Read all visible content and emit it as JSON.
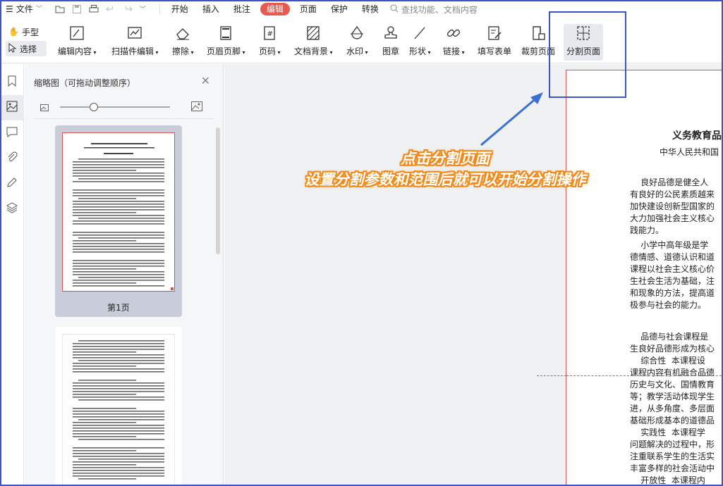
{
  "menubar": {
    "file": "文件",
    "tabs": [
      "开始",
      "插入",
      "批注",
      "编辑",
      "页面",
      "保护",
      "转换"
    ],
    "active_tab": "编辑",
    "search_placeholder": "查找功能、文档内容"
  },
  "toolbar": {
    "hand": "手型",
    "select": "选择",
    "tools": [
      {
        "label": "编辑内容",
        "icon": "edit-content-icon"
      },
      {
        "label": "扫描件编辑",
        "icon": "scan-edit-icon"
      },
      {
        "label": "擦除",
        "icon": "eraser-icon"
      },
      {
        "label": "页眉页脚",
        "icon": "header-footer-icon"
      },
      {
        "label": "页码",
        "icon": "page-number-icon"
      },
      {
        "label": "文档背景",
        "icon": "background-icon"
      },
      {
        "label": "水印",
        "icon": "watermark-icon"
      },
      {
        "label": "图章",
        "icon": "stamp-icon"
      },
      {
        "label": "形状",
        "icon": "shape-icon"
      },
      {
        "label": "链接",
        "icon": "link-icon"
      },
      {
        "label": "填写表单",
        "icon": "form-icon"
      },
      {
        "label": "裁剪页面",
        "icon": "crop-icon"
      },
      {
        "label": "分割页面",
        "icon": "split-page-icon"
      }
    ]
  },
  "thumbnails": {
    "title": "缩略图（可拖动调整顺序）",
    "page1_label": "第1页"
  },
  "document": {
    "title": "义务教育品",
    "subtitle": "中华人民共和国",
    "paragraphs": [
      "    良好品德是健全人",
      "有良好的公民素质越来",
      "加快建设创新型国家的",
      "大力加强社会主义核心",
      "践能力。",
      "    小学中高年级是学",
      "德情感、道德认识和道",
      "课程以社会主义核心价",
      "生社会生活为基础，注",
      "和现象的方法，提高道",
      "极参与社会的能力。",
      "",
      "",
      "    品德与社会课程是",
      "生良好品德形成为核心",
      "    综合性  本课程设",
      "课程内容有机融合品德",
      "历史与文化、国情教育",
      "等；教学活动体现学生",
      "进，从多角度、多层面",
      "基础形成基本的道德品",
      "    实践性  本课程学",
      "问题解决的过程中，形",
      "注重联系学生的生活实",
      "丰富多样的社会活动中",
      "    开放性  本课程内",
      "有弹性地吸纳鲜活的社"
    ]
  },
  "annotation": {
    "line1": "点击分割页面",
    "line2": "设置分割参数和范围后就可以开始分割操作"
  },
  "colors": {
    "accent_tab": "#e85a4f",
    "annotation_blue": "#3b55c8",
    "callout_orange": "#f28a1a"
  }
}
